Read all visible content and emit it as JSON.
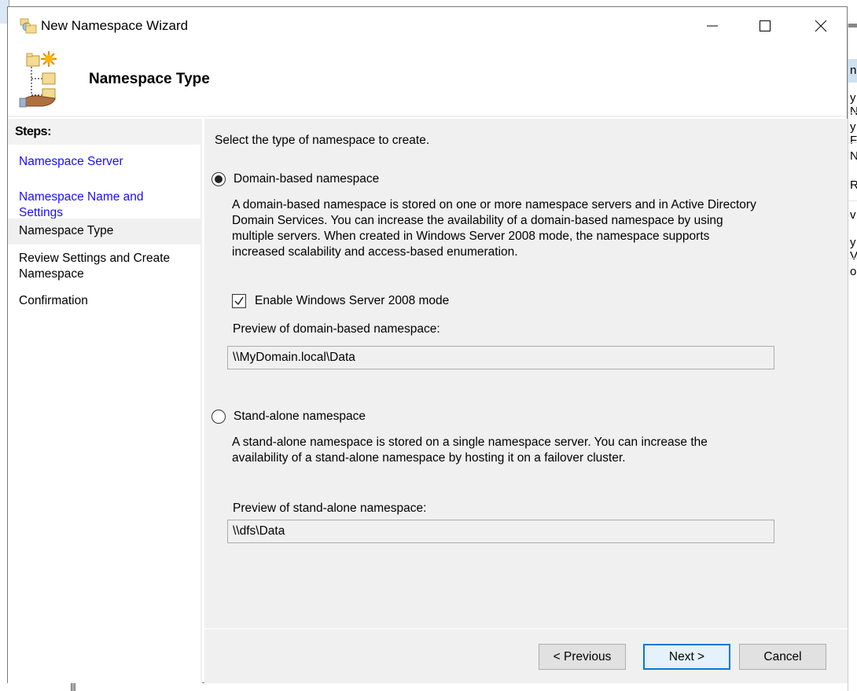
{
  "window": {
    "title": "New Namespace Wizard",
    "controls": [
      "minimize",
      "maximize",
      "close"
    ]
  },
  "header": {
    "title": "Namespace Type"
  },
  "steps": {
    "heading": "Steps:",
    "items": [
      {
        "label": "Namespace Server",
        "state": "completed-link"
      },
      {
        "label": "Namespace Name and Settings",
        "state": "completed-link"
      },
      {
        "label": "Namespace Type",
        "state": "current"
      },
      {
        "label": "Review Settings and Create Namespace",
        "line1": "Review Settings and Create",
        "line2": "Namespace",
        "state": "pending"
      },
      {
        "label": "Confirmation",
        "state": "pending"
      }
    ]
  },
  "content": {
    "instruction": "Select the type of namespace to create.",
    "domain_option": {
      "label": "Domain-based namespace",
      "selected": true,
      "description_lines": [
        "A domain-based namespace is stored on one or more namespace servers and in Active Directory",
        "Domain Services. You can increase the availability of a domain-based namespace by using",
        "multiple servers. When created in Windows Server 2008 mode, the namespace supports",
        "increased scalability and access-based enumeration."
      ],
      "mode_checkbox": {
        "label": "Enable Windows Server 2008 mode",
        "checked": true
      },
      "preview_label": "Preview of domain-based namespace:",
      "preview_value": "\\\\MyDomain.local\\Data"
    },
    "standalone_option": {
      "label": "Stand-alone namespace",
      "selected": false,
      "description_lines": [
        "A stand-alone namespace is stored on a single namespace server. You can increase the",
        "availability of a stand-alone namespace by hosting it on a failover cluster."
      ],
      "preview_label": "Preview of stand-alone namespace:",
      "preview_value": "\\\\dfs\\Data"
    }
  },
  "footer": {
    "previous_label": "< Previous",
    "next_label": "Next >",
    "cancel_label": "Cancel"
  },
  "background_app": {
    "fragments": [
      "na",
      "y N",
      "y F",
      "N",
      "R",
      "v",
      "y V",
      "o"
    ]
  },
  "colors": {
    "link": "#1a0dff",
    "focus_border": "#0078d7",
    "panel_bg": "#f0f0f0"
  }
}
